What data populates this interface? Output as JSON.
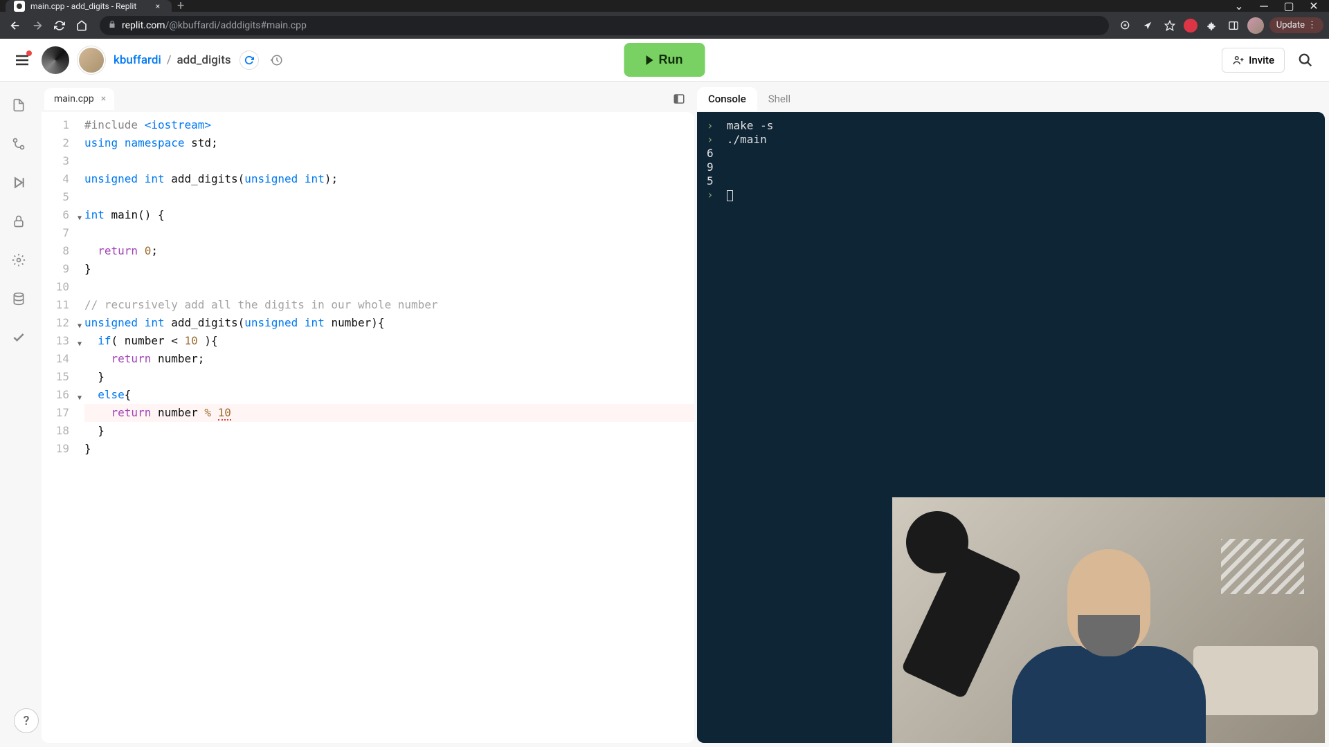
{
  "browser": {
    "tab_title": "main.cpp - add_digits - Replit",
    "url_host": "replit.com",
    "url_path": "/@kbuffardi/adddigits#main.cpp",
    "update_label": "Update"
  },
  "header": {
    "username": "kbuffardi",
    "separator": "/",
    "project": "add_digits",
    "run_label": "Run",
    "invite_label": "Invite"
  },
  "editor": {
    "tab_name": "main.cpp",
    "code": [
      {
        "num": "1",
        "fold": false,
        "html": "<span class='kw-inc'>#include</span> <span class='kw-lib'>&lt;iostream&gt;</span>"
      },
      {
        "num": "2",
        "fold": false,
        "html": "<span class='kw-type'>using</span> <span class='kw-ns'>namespace</span> <span class='kw-ident'>std</span>;"
      },
      {
        "num": "3",
        "fold": false,
        "html": ""
      },
      {
        "num": "4",
        "fold": false,
        "html": "<span class='kw-type'>unsigned</span> <span class='kw-type'>int</span> <span class='kw-fn'>add_digits</span>(<span class='kw-type'>unsigned</span> <span class='kw-type'>int</span>);"
      },
      {
        "num": "5",
        "fold": false,
        "html": ""
      },
      {
        "num": "6",
        "fold": true,
        "html": "<span class='kw-type'>int</span> <span class='kw-fn'>main</span>() {"
      },
      {
        "num": "7",
        "fold": false,
        "html": "  "
      },
      {
        "num": "8",
        "fold": false,
        "html": "  <span class='kw-ret'>return</span> <span class='kw-num'>0</span>;"
      },
      {
        "num": "9",
        "fold": false,
        "html": "}"
      },
      {
        "num": "10",
        "fold": false,
        "html": ""
      },
      {
        "num": "11",
        "fold": false,
        "html": "<span class='kw-cmt'>// recursively add all the digits in our whole number</span>"
      },
      {
        "num": "12",
        "fold": true,
        "html": "<span class='kw-type'>unsigned</span> <span class='kw-type'>int</span> <span class='kw-fn'>add_digits</span>(<span class='kw-type'>unsigned</span> <span class='kw-type'>int</span> number){"
      },
      {
        "num": "13",
        "fold": true,
        "html": "  <span class='kw-kwrd'>if</span>( number &lt; <span class='kw-num'>10</span> ){"
      },
      {
        "num": "14",
        "fold": false,
        "html": "    <span class='kw-ret'>return</span> number;"
      },
      {
        "num": "15",
        "fold": false,
        "html": "  }"
      },
      {
        "num": "16",
        "fold": true,
        "html": "  <span class='kw-kwrd'>else</span>{"
      },
      {
        "num": "17",
        "fold": false,
        "active": true,
        "html": "    <span class='kw-ret'>return</span> number <span class='kw-num'>%</span> <span class='kw-num sq-under'>10</span>"
      },
      {
        "num": "18",
        "fold": false,
        "html": "  }"
      },
      {
        "num": "19",
        "fold": false,
        "html": "}"
      }
    ]
  },
  "output": {
    "tabs": {
      "console": "Console",
      "shell": "Shell"
    },
    "lines": [
      {
        "prompt": true,
        "text": "make -s"
      },
      {
        "prompt": true,
        "text": "./main"
      },
      {
        "prompt": false,
        "text": "6"
      },
      {
        "prompt": false,
        "text": "9"
      },
      {
        "prompt": false,
        "text": "5"
      }
    ]
  },
  "help_label": "?"
}
